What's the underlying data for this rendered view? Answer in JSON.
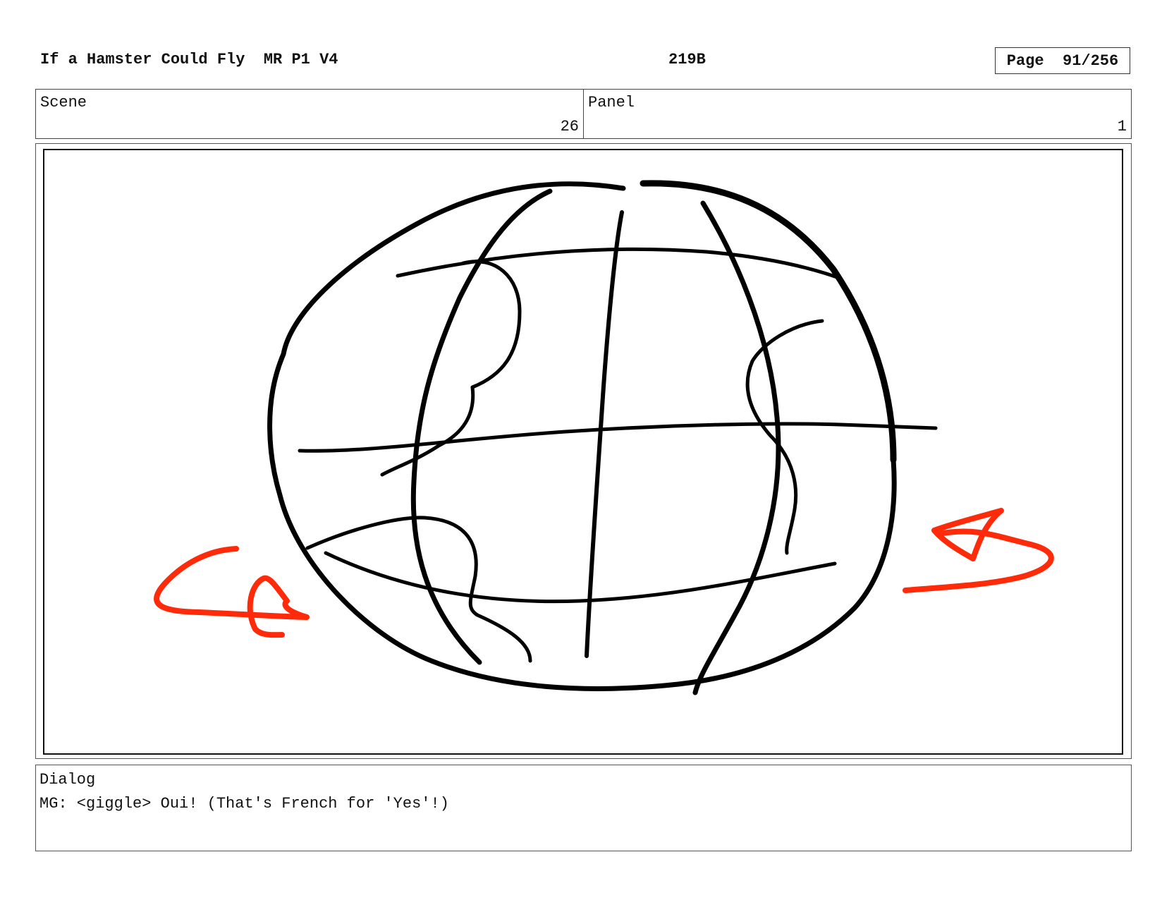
{
  "header": {
    "title": "If a Hamster Could Fly  MR P1 V4",
    "code": "219B",
    "page_label": "Page",
    "page_number": "91/256"
  },
  "scene": {
    "label": "Scene",
    "value": "26"
  },
  "panel": {
    "label": "Panel",
    "value": "1"
  },
  "drawing": {
    "line_color": "#000000",
    "arrow_color": "#ff2a0a"
  },
  "dialog": {
    "label": "Dialog",
    "text": "MG: <giggle> Oui! (That's French for 'Yes'!)"
  }
}
